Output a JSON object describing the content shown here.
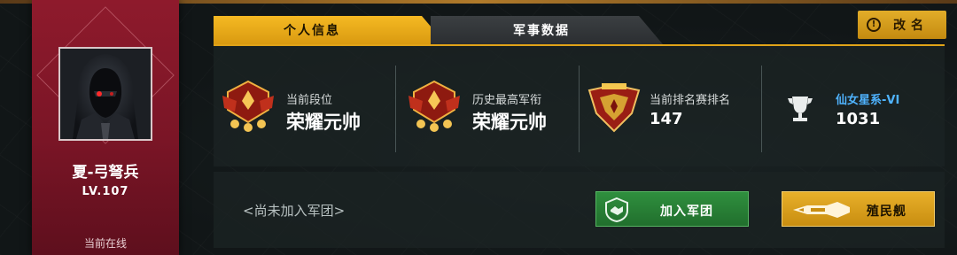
{
  "profile": {
    "name": "夏-弓弩兵",
    "level": "LV.107",
    "status": "当前在线",
    "accent_color": "#8e1a2c"
  },
  "tabs": [
    {
      "label": "个人信息",
      "active": true
    },
    {
      "label": "军事数据",
      "active": false
    }
  ],
  "rename_button": {
    "label": "改名",
    "icon": "info-circle-icon"
  },
  "stats": {
    "current_rank": {
      "label": "当前段位",
      "value": "荣耀元帅",
      "icon": "marshal-rank-badge-icon"
    },
    "highest_rank": {
      "label": "历史最高军衔",
      "value": "荣耀元帅",
      "icon": "marshal-rank-badge-icon"
    },
    "ranked_position": {
      "label": "当前排名赛排名",
      "value": "147",
      "icon": "ranking-medal-icon"
    },
    "galaxy": {
      "label": "仙女星系-VI",
      "value": "1031",
      "icon": "trophy-cup-icon"
    }
  },
  "legion": {
    "status_text": "<尚未加入军团>",
    "join_button": "加入军团",
    "ship_button": "殖民舰"
  },
  "colors": {
    "gold": "#e0a318",
    "green": "#2f8f3e",
    "link_blue": "#4fb3ff"
  }
}
